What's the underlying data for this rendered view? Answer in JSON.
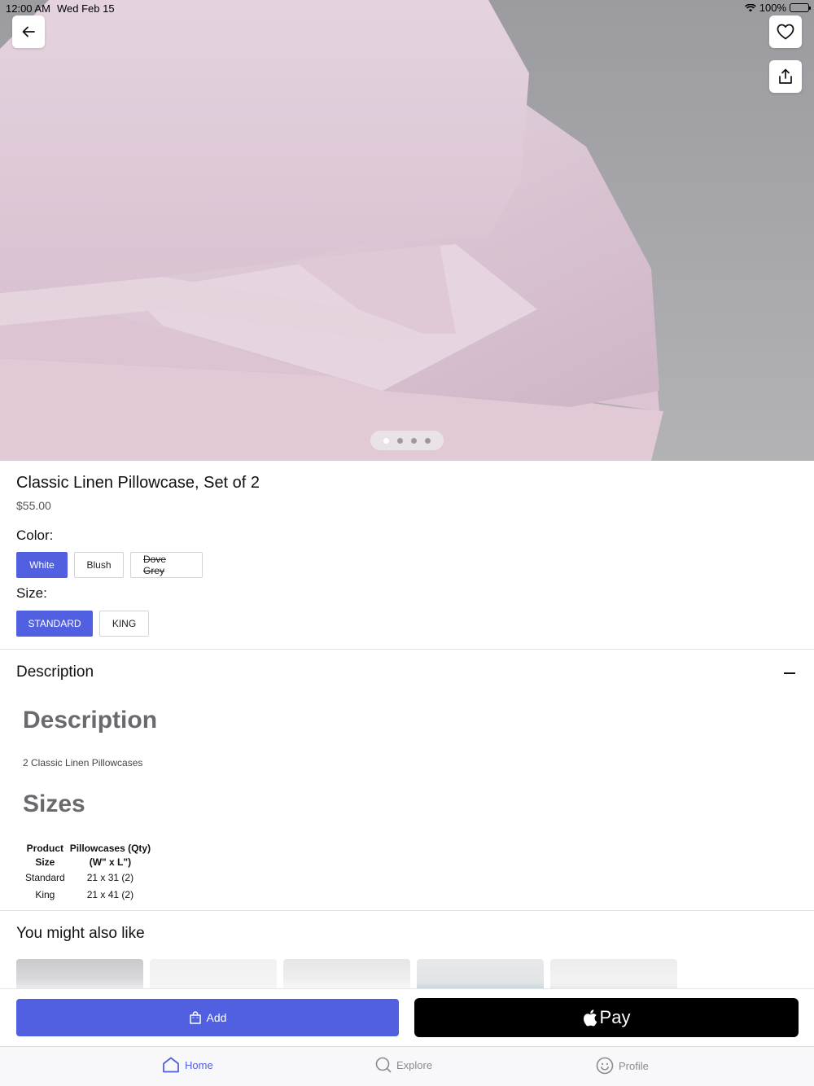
{
  "status_bar": {
    "time": "12:00 AM",
    "date": "Wed Feb 15",
    "battery": "100%"
  },
  "hero": {
    "image_description_icon": "pink-linen-pillowcase-photo",
    "dot_count": 4,
    "active_dot": 0
  },
  "product": {
    "title": "Classic Linen Pillowcase, Set of 2",
    "price": "$55.00",
    "color_label": "Color:",
    "colors": [
      {
        "label": "White",
        "state": "selected"
      },
      {
        "label": "Blush",
        "state": "available"
      },
      {
        "label": "Dove Grey",
        "state": "unavailable"
      }
    ],
    "size_label": "Size:",
    "sizes": [
      {
        "label": "STANDARD",
        "state": "selected"
      },
      {
        "label": "KING",
        "state": "available"
      }
    ]
  },
  "description": {
    "section_title": "Description",
    "heading": "Description",
    "text": "2 Classic Linen Pillowcases",
    "sizes_heading": "Sizes",
    "table": {
      "headers": [
        [
          "Product",
          "Size"
        ],
        [
          "Pillowcases (Qty)",
          "(W\" x L\")"
        ]
      ],
      "rows": [
        [
          "Standard",
          "21 x 31 (2)"
        ],
        [
          "King",
          "21 x 41 (2)"
        ]
      ]
    }
  },
  "recommendations": {
    "title": "You might also like"
  },
  "actions": {
    "add_label": "Add",
    "pay_label": "Pay"
  },
  "tabs": [
    {
      "label": "Home",
      "icon": "home-icon",
      "active": true
    },
    {
      "label": "Explore",
      "icon": "search-icon",
      "active": false
    },
    {
      "label": "Profile",
      "icon": "smiley-icon",
      "active": false
    }
  ],
  "colors": {
    "accent": "#5060e0",
    "pay_button": "#000000"
  }
}
